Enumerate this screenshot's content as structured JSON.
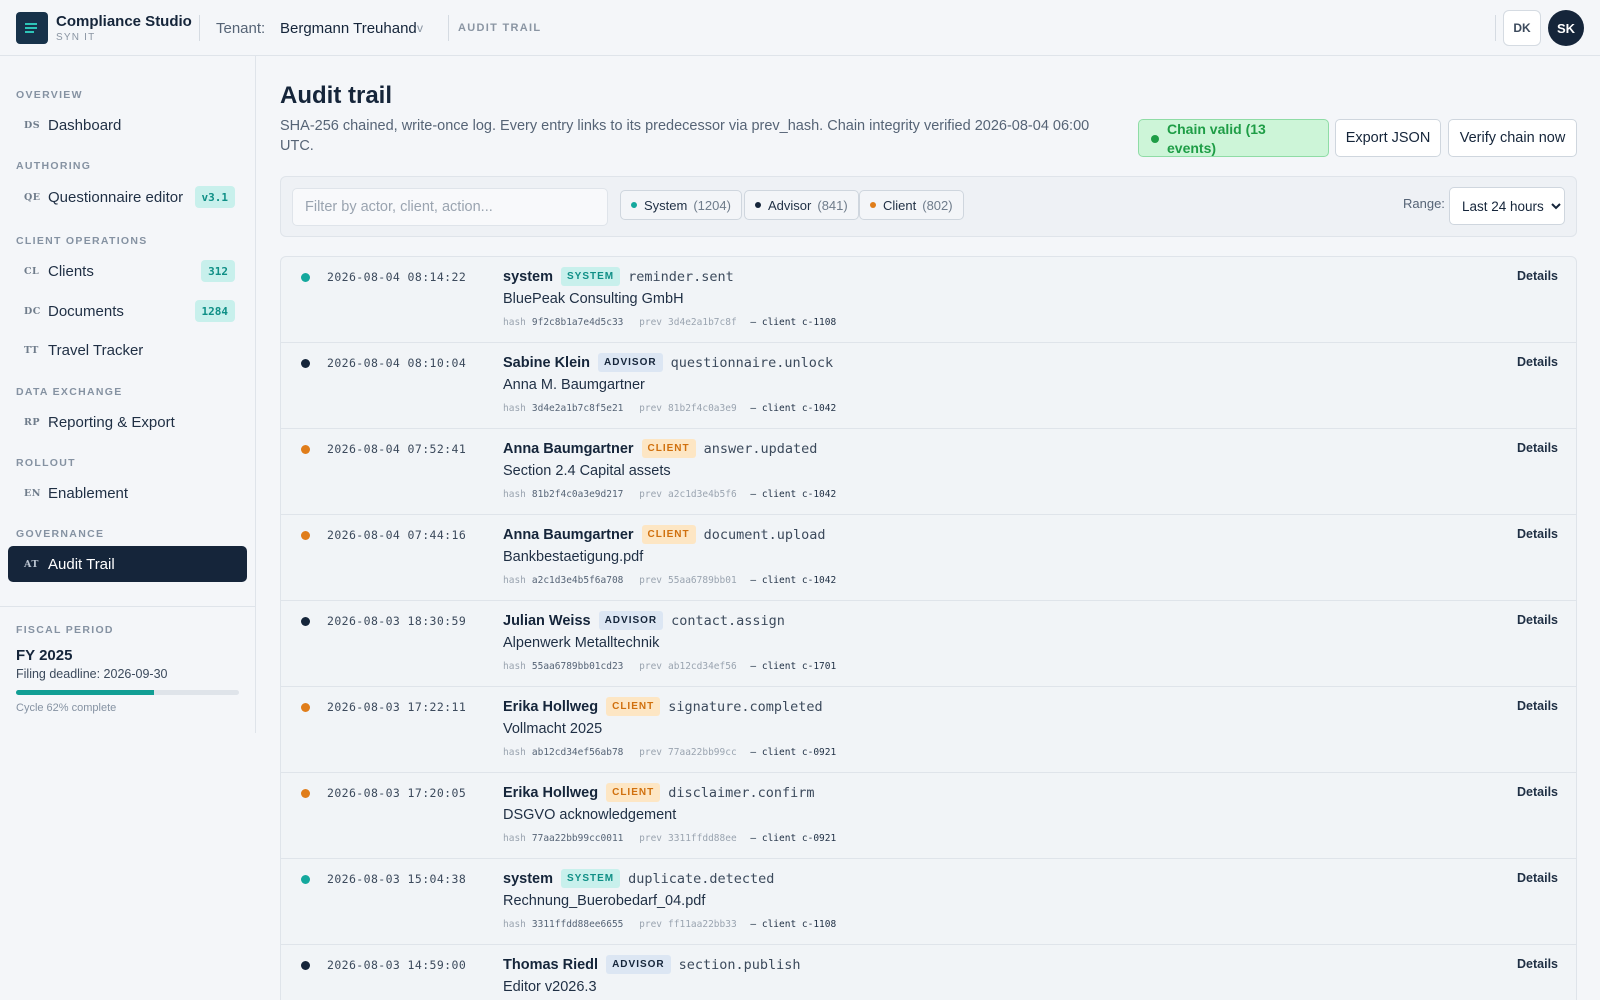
{
  "header": {
    "app_title": "Compliance Studio",
    "app_subtitle": "SYN IT",
    "tenant_label": "Tenant:",
    "tenant_value": "Bergmann Treuhand",
    "tenant_caret": "v",
    "breadcrumb": "AUDIT TRAIL",
    "lang_button": "DK",
    "avatar_initials": "SK"
  },
  "sidebar": {
    "sections": [
      {
        "label": "OVERVIEW"
      },
      {
        "label": "AUTHORING"
      },
      {
        "label": "CLIENT OPERATIONS"
      },
      {
        "label": "DATA EXCHANGE"
      },
      {
        "label": "ROLLOUT"
      },
      {
        "label": "GOVERNANCE"
      }
    ],
    "items": [
      {
        "abbr": "DS",
        "label": "Dashboard",
        "badge": ""
      },
      {
        "abbr": "QE",
        "label": "Questionnaire editor",
        "badge": "v3.1"
      },
      {
        "abbr": "CL",
        "label": "Clients",
        "badge": "312"
      },
      {
        "abbr": "DC",
        "label": "Documents",
        "badge": "1284"
      },
      {
        "abbr": "TT",
        "label": "Travel Tracker",
        "badge": ""
      },
      {
        "abbr": "RP",
        "label": "Reporting & Export",
        "badge": ""
      },
      {
        "abbr": "EN",
        "label": "Enablement",
        "badge": ""
      },
      {
        "abbr": "AT",
        "label": "Audit Trail",
        "badge": "",
        "active": true
      }
    ],
    "fiscal": {
      "label": "FISCAL PERIOD",
      "title": "FY 2025",
      "deadline": "Filing deadline: 2026-09-30",
      "progress": 0.62,
      "cycle_text": "Cycle 62% complete"
    }
  },
  "main": {
    "title": "Audit trail",
    "description": "SHA-256 chained, write-once log. Every entry links to its predecessor via prev_hash. Chain integrity verified 2026-08-04 06:00 UTC.",
    "chain_status": "Chain valid (13 events)",
    "export_button": "Export JSON",
    "verify_button": "Verify chain now",
    "search_placeholder": "Filter by actor, client, action...",
    "filters": [
      {
        "label": "System",
        "count": "(1204)",
        "color": "#14a89d"
      },
      {
        "label": "Advisor",
        "count": "(841)",
        "color": "#15253a"
      },
      {
        "label": "Client",
        "count": "(802)",
        "color": "#e07d1a"
      }
    ],
    "range_label": "Range:",
    "range_value": "Last 24 hours",
    "details_label": "Details",
    "meta_hash_label": "hash",
    "meta_prev_label": "prev",
    "events": [
      {
        "ts": "2026-08-04 08:14:22",
        "actor": "system",
        "role": "SYSTEM",
        "action": "reminder.sent",
        "subject": "BluePeak Consulting GmbH",
        "hash": "9f2c8b1a7e4d5c33",
        "prev": "3d4e2a1b7c8f",
        "client": "– client c-1108"
      },
      {
        "ts": "2026-08-04 08:10:04",
        "actor": "Sabine Klein",
        "role": "ADVISOR",
        "action": "questionnaire.unlock",
        "subject": "Anna M. Baumgartner",
        "hash": "3d4e2a1b7c8f5e21",
        "prev": "81b2f4c0a3e9",
        "client": "– client c-1042"
      },
      {
        "ts": "2026-08-04 07:52:41",
        "actor": "Anna Baumgartner",
        "role": "CLIENT",
        "action": "answer.updated",
        "subject": "Section 2.4 Capital assets",
        "hash": "81b2f4c0a3e9d217",
        "prev": "a2c1d3e4b5f6",
        "client": "– client c-1042"
      },
      {
        "ts": "2026-08-04 07:44:16",
        "actor": "Anna Baumgartner",
        "role": "CLIENT",
        "action": "document.upload",
        "subject": "Bankbestaetigung.pdf",
        "hash": "a2c1d3e4b5f6a708",
        "prev": "55aa6789bb01",
        "client": "– client c-1042"
      },
      {
        "ts": "2026-08-03 18:30:59",
        "actor": "Julian Weiss",
        "role": "ADVISOR",
        "action": "contact.assign",
        "subject": "Alpenwerk Metalltechnik",
        "hash": "55aa6789bb01cd23",
        "prev": "ab12cd34ef56",
        "client": "– client c-1701"
      },
      {
        "ts": "2026-08-03 17:22:11",
        "actor": "Erika Hollweg",
        "role": "CLIENT",
        "action": "signature.completed",
        "subject": "Vollmacht 2025",
        "hash": "ab12cd34ef56ab78",
        "prev": "77aa22bb99cc",
        "client": "– client c-0921"
      },
      {
        "ts": "2026-08-03 17:20:05",
        "actor": "Erika Hollweg",
        "role": "CLIENT",
        "action": "disclaimer.confirm",
        "subject": "DSGVO acknowledgement",
        "hash": "77aa22bb99cc0011",
        "prev": "3311ffdd88ee",
        "client": "– client c-0921"
      },
      {
        "ts": "2026-08-03 15:04:38",
        "actor": "system",
        "role": "SYSTEM",
        "action": "duplicate.detected",
        "subject": "Rechnung_Buerobedarf_04.pdf",
        "hash": "3311ffdd88ee6655",
        "prev": "ff11aa22bb33",
        "client": "– client c-1108"
      },
      {
        "ts": "2026-08-03 14:59:00",
        "actor": "Thomas Riedl",
        "role": "ADVISOR",
        "action": "section.publish",
        "subject": "Editor v2026.3",
        "hash": "",
        "prev": "",
        "client": ""
      }
    ]
  },
  "colors": {
    "system": "#14a89d",
    "advisor": "#15253a",
    "client": "#e07d1a",
    "system_badge_bg": "#c8f0ec",
    "system_badge_fg": "#0f8f86",
    "advisor_badge_bg": "#dce6f3",
    "advisor_badge_fg": "#15253a",
    "client_badge_bg": "#fde6c4",
    "client_badge_fg": "#d0700e"
  }
}
